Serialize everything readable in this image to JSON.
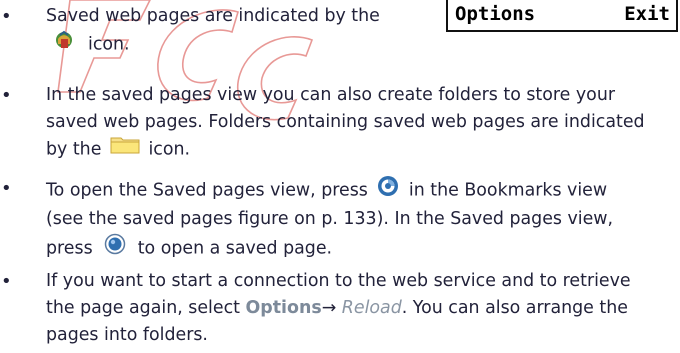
{
  "softkeys": {
    "left": "Options",
    "right": "Exit"
  },
  "watermark": {
    "text": "FCC",
    "color": "#e07a78"
  },
  "items": [
    {
      "line1_before": "Saved web pages are indicated by the",
      "line2_after": "icon."
    },
    {
      "line1": "In the saved pages view you can also create folders to store your",
      "line2": "saved web pages. Folders containing saved web pages are indicated",
      "line3_before": "by the",
      "line3_after": "icon."
    },
    {
      "line1_before": "To open the Saved pages view, press",
      "line1_after": "in the Bookmarks view",
      "line2": "(see the saved pages figure on p. 133). In the Saved pages view,",
      "line3_before": "press",
      "line3_after": "to open a saved page."
    },
    {
      "line1": "If you want to start a connection to the web service and to retrieve",
      "line2_before": "the page again, select",
      "options_word": "Options",
      "arrow": "→",
      "reload_word": "Reload",
      "line2_after": ". You can also arrange the",
      "line3": "pages into folders."
    }
  ],
  "icons": {
    "saved_page": "saved-page-icon",
    "folder": "folder-icon",
    "navi_key": "navi-key-icon",
    "select_key": "select-key-icon"
  },
  "bullet_char": "•"
}
